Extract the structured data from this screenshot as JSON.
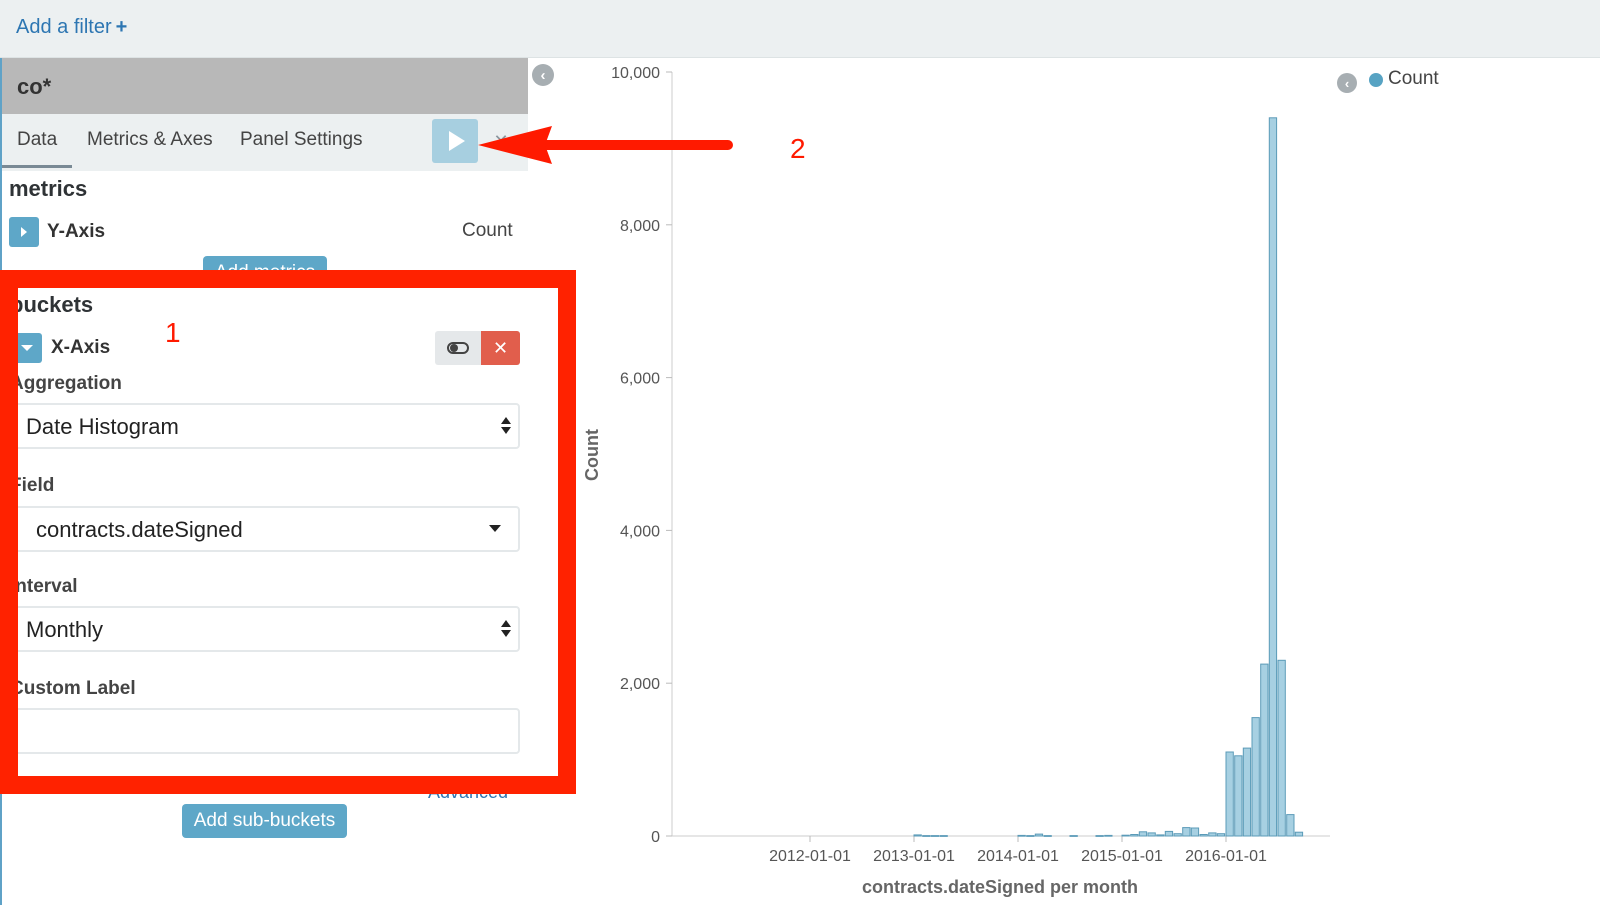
{
  "filter_bar": {
    "add_filter_label": "Add a filter",
    "plus_icon": "+"
  },
  "sidebar": {
    "index_pattern": "co*",
    "tabs": [
      {
        "label": "Data",
        "active": true
      },
      {
        "label": "Metrics & Axes",
        "active": false
      },
      {
        "label": "Panel Settings",
        "active": false
      }
    ],
    "apply_icon": "play-icon",
    "discard_icon": "close-icon",
    "metrics": {
      "title": "metrics",
      "agg_label": "Y-Axis",
      "agg_value": "Count",
      "add_button": "Add metrics"
    },
    "buckets": {
      "title": "buckets",
      "agg_label": "X-Axis",
      "aggregation_label": "Aggregation",
      "aggregation_value": "Date Histogram",
      "field_label": "Field",
      "field_value": "contracts.dateSigned",
      "interval_label": "Interval",
      "interval_value": "Monthly",
      "custom_label_label": "Custom Label",
      "custom_label_value": "",
      "advanced_link": "Advanced",
      "add_sub_buckets": "Add sub-buckets"
    }
  },
  "annotations": {
    "one": "1",
    "two": "2",
    "highlight_color": "#ff2200"
  },
  "legend": {
    "label": "Count",
    "color": "#57a3c3"
  },
  "chart_data": {
    "type": "bar",
    "ylabel": "Count",
    "xlabel": "contracts.dateSigned per month",
    "ylim": [
      0,
      10000
    ],
    "yticks": [
      0,
      2000,
      4000,
      6000,
      8000,
      10000
    ],
    "ytick_labels": [
      "0",
      "2,000",
      "4,000",
      "6,000",
      "8,000",
      "10,000"
    ],
    "xtick_labels": [
      "2012-01-01",
      "2013-01-01",
      "2014-01-01",
      "2015-01-01",
      "2016-01-01"
    ],
    "x": [
      "2013-01",
      "2013-02",
      "2013-03",
      "2013-04",
      "2014-01",
      "2014-02",
      "2014-03",
      "2014-04",
      "2014-07",
      "2014-10",
      "2014-11",
      "2015-01",
      "2015-02",
      "2015-03",
      "2015-04",
      "2015-05",
      "2015-06",
      "2015-07",
      "2015-08",
      "2015-09",
      "2015-10",
      "2015-11",
      "2015-12",
      "2016-01",
      "2016-02",
      "2016-03",
      "2016-04",
      "2016-05",
      "2016-06",
      "2016-07",
      "2016-08",
      "2016-09"
    ],
    "values": [
      15,
      5,
      5,
      5,
      8,
      5,
      25,
      5,
      5,
      5,
      8,
      10,
      20,
      55,
      40,
      15,
      60,
      30,
      110,
      105,
      20,
      40,
      30,
      1100,
      1050,
      1150,
      1550,
      2250,
      9400,
      2300,
      280,
      50
    ],
    "bar_color": "#a7d0e2",
    "bar_stroke": "#5b9bb8"
  }
}
